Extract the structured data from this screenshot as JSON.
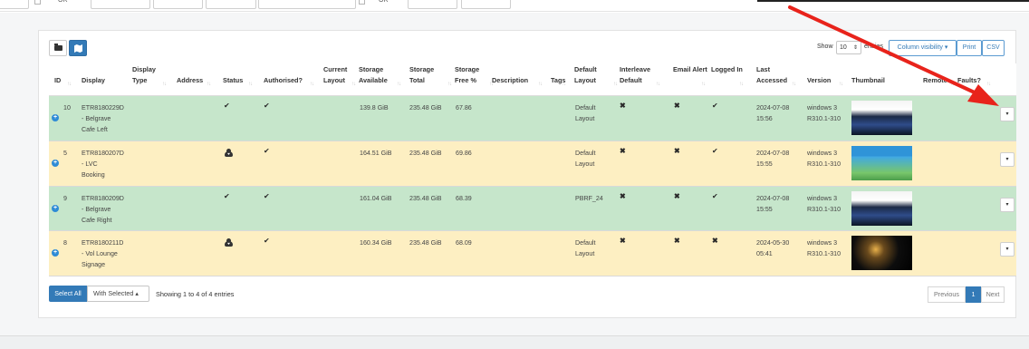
{
  "topbar": {
    "filters": [
      {
        "kind": "select",
        "value": "OR"
      },
      {
        "kind": "select",
        "value": "OR"
      }
    ]
  },
  "toolbar": {
    "show_label": "Show",
    "page_size": "10",
    "entries_label": "entries",
    "column_visibility": "Column visibility",
    "print": "Print",
    "csv": "CSV"
  },
  "columns": [
    {
      "key": "id",
      "label": "ID"
    },
    {
      "key": "display",
      "label": "Display"
    },
    {
      "key": "display_type",
      "label": "Display Type"
    },
    {
      "key": "address",
      "label": "Address"
    },
    {
      "key": "status",
      "label": "Status"
    },
    {
      "key": "authorised",
      "label": "Authorised?"
    },
    {
      "key": "current_layout",
      "label": "Current Layout"
    },
    {
      "key": "storage_available",
      "label": "Storage Available"
    },
    {
      "key": "storage_total",
      "label": "Storage Total"
    },
    {
      "key": "storage_free",
      "label": "Storage Free %"
    },
    {
      "key": "description",
      "label": "Description"
    },
    {
      "key": "tags",
      "label": "Tags"
    },
    {
      "key": "default_layout",
      "label": "Default Layout"
    },
    {
      "key": "interleave",
      "label": "Interleave Default"
    },
    {
      "key": "email_alert",
      "label": "Email Alert"
    },
    {
      "key": "logged_in",
      "label": "Logged In"
    },
    {
      "key": "last_accessed",
      "label": "Last Accessed"
    },
    {
      "key": "version",
      "label": "Version"
    },
    {
      "key": "thumbnail",
      "label": "Thumbnail"
    },
    {
      "key": "remote",
      "label": "Remote"
    },
    {
      "key": "faults",
      "label": "Faults?"
    }
  ],
  "rows": [
    {
      "id": "10",
      "display": [
        "ETR8180229D",
        "- Belgrave",
        "Cafe Left"
      ],
      "status_icon": "check-icon",
      "authorised": true,
      "storage_available": "139.8 GiB",
      "storage_total": "235.48 GiB",
      "storage_free": "67.86",
      "default_layout": [
        "Default",
        "Layout"
      ],
      "interleave": false,
      "email_alert": false,
      "logged_in": true,
      "last_accessed": [
        "2024-07-08",
        "15:56"
      ],
      "version": [
        "windows 3",
        "R310.1-310"
      ],
      "thumbnail_icon": "running-festival-thumbnail",
      "highlight": "green"
    },
    {
      "id": "5",
      "display": [
        "ETR8180207D",
        "- LVC",
        "Booking"
      ],
      "status_icon": "cloud-download-icon",
      "authorised": true,
      "storage_available": "164.51 GiB",
      "storage_total": "235.48 GiB",
      "storage_free": "69.86",
      "default_layout": [
        "Default",
        "Layout"
      ],
      "interleave": false,
      "email_alert": false,
      "logged_in": true,
      "last_accessed": [
        "2024-07-08",
        "15:55"
      ],
      "version": [
        "windows 3",
        "R310.1-310"
      ],
      "thumbnail_icon": "train-poster-thumbnail",
      "highlight": "yellow"
    },
    {
      "id": "9",
      "display": [
        "ETR8180209D",
        "- Belgrave",
        "Cafe Right"
      ],
      "status_icon": "check-icon",
      "authorised": true,
      "storage_available": "161.04 GiB",
      "storage_total": "235.48 GiB",
      "storage_free": "68.39",
      "default_layout": [
        "PBRF_24"
      ],
      "interleave": false,
      "email_alert": false,
      "logged_in": true,
      "last_accessed": [
        "2024-07-08",
        "15:55"
      ],
      "version": [
        "windows 3",
        "R310.1-310"
      ],
      "thumbnail_icon": "running-festival-thumbnail",
      "highlight": "green"
    },
    {
      "id": "8",
      "display": [
        "ETR8180211D",
        "- Vol Lounge",
        "Signage"
      ],
      "status_icon": "cloud-download-icon",
      "authorised": true,
      "storage_available": "160.34 GiB",
      "storage_total": "235.48 GiB",
      "storage_free": "68.09",
      "default_layout": [
        "Default",
        "Layout"
      ],
      "interleave": false,
      "email_alert": false,
      "logged_in": false,
      "last_accessed": [
        "2024-05-30",
        "05:41"
      ],
      "version": [
        "windows 3",
        "R310.1-310"
      ],
      "thumbnail_icon": "night-train-thumbnail",
      "highlight": "yellow"
    }
  ],
  "footer": {
    "select_all": "Select All",
    "with_selected": "With Selected",
    "info": "Showing 1 to 4 of 4 entries",
    "previous": "Previous",
    "page": "1",
    "next": "Next"
  },
  "colors": {
    "primary": "#337ab7",
    "row_green": "#c6e6cb",
    "row_yellow": "#fdefc2",
    "annotation_arrow": "#e8231b"
  }
}
